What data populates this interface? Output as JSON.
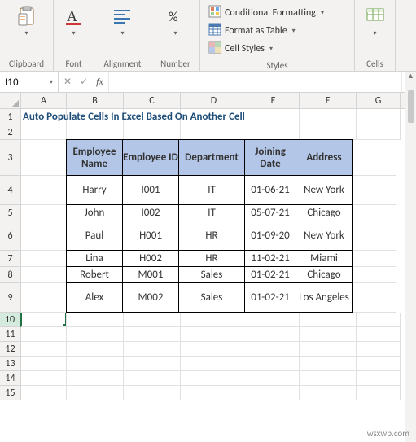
{
  "ribbon": {
    "groups": {
      "clipboard": {
        "label": "Clipboard"
      },
      "font": {
        "label": "Font"
      },
      "alignment": {
        "label": "Alignment"
      },
      "number": {
        "label": "Number"
      },
      "styles": {
        "label": "Styles",
        "conditional": "Conditional Formatting",
        "table": "Format as Table",
        "cellStyles": "Cell Styles"
      },
      "cells": {
        "label": "Cells"
      }
    }
  },
  "formulaBar": {
    "nameBox": "I10",
    "fx": "fx",
    "formula": ""
  },
  "columns": [
    "A",
    "B",
    "C",
    "D",
    "E",
    "F",
    "G"
  ],
  "rowLabels": [
    "1",
    "2",
    "3",
    "4",
    "5",
    "6",
    "7",
    "8",
    "9",
    "10",
    "11",
    "12",
    "13",
    "14",
    "15"
  ],
  "title": "Auto Populate Cells In Excel Based On Another Cell",
  "table": {
    "headers": [
      "Employee Name",
      "Employee ID",
      "Department",
      "Joining Date",
      "Address"
    ],
    "rows": [
      [
        "Harry",
        "I001",
        "IT",
        "01-06-21",
        "New York"
      ],
      [
        "John",
        "I002",
        "IT",
        "05-07-21",
        "Chicago"
      ],
      [
        "Paul",
        "H001",
        "HR",
        "01-09-20",
        "New York"
      ],
      [
        "Lina",
        "H002",
        "HR",
        "11-02-21",
        "Miami"
      ],
      [
        "Robert",
        "M001",
        "Sales",
        "01-02-21",
        "Chicago"
      ],
      [
        "Alex",
        "M002",
        "Sales",
        "01-02-21",
        "Los Angeles"
      ]
    ]
  },
  "activeCell": "A10",
  "watermark": "wsxwp.com",
  "chart_data": {
    "type": "table",
    "title": "Auto Populate Cells In Excel Based On Another Cell",
    "columns": [
      "Employee Name",
      "Employee ID",
      "Department",
      "Joining Date",
      "Address"
    ],
    "rows": [
      [
        "Harry",
        "I001",
        "IT",
        "01-06-21",
        "New York"
      ],
      [
        "John",
        "I002",
        "IT",
        "05-07-21",
        "Chicago"
      ],
      [
        "Paul",
        "H001",
        "HR",
        "01-09-20",
        "New York"
      ],
      [
        "Lina",
        "H002",
        "HR",
        "11-02-21",
        "Miami"
      ],
      [
        "Robert",
        "M001",
        "Sales",
        "01-02-21",
        "Chicago"
      ],
      [
        "Alex",
        "M002",
        "Sales",
        "01-02-21",
        "Los Angeles"
      ]
    ]
  }
}
